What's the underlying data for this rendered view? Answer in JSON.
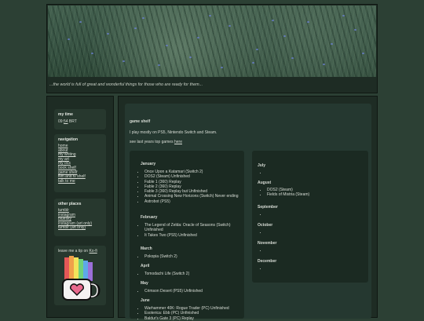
{
  "header": {
    "tagline": "...the world is full of great and wonderful things for those who are ready for them..."
  },
  "sidebar": {
    "time": {
      "title": "my time",
      "value_prefix": "09:",
      "value_link": "54",
      "value_suffix": " BRT"
    },
    "navigation": {
      "title": "navigation",
      "items": [
        "home",
        "about",
        "my writing",
        "my art",
        "my ocs",
        "book shelf",
        "game shelf",
        "film and tv shelf",
        "talk to me"
      ]
    },
    "other_places": {
      "title": "other places",
      "items": [
        "tumblr",
        "instagram",
        "bluesky",
        "instagram (art only)",
        "tumblr (art only)"
      ]
    },
    "kofi": {
      "text": "leave me a tip on ",
      "link": "Ko-fi"
    }
  },
  "main": {
    "title": "game shelf",
    "intro": "I play mostly on PS5, Nintendo Switch and Steam.",
    "last_year_prefix": "see last years top games ",
    "last_year_link": "here",
    "left_months": [
      {
        "name": "January",
        "games": [
          "Once Upon a Katamari (Switch 2)",
          "DOS2 (Steam) Unfinished",
          "Fable 1 (360) Replay",
          "Fable 2 (360) Replay",
          "Fable 3 (360) Replay but Unfinished",
          "Animal Crossing New Horizons (Switch) Never ending",
          "Astrobot (PS5)"
        ]
      },
      {
        "name": "February",
        "games": [
          "The Legend of Zelda: Oracle of Seasons (Switch) Unfinished",
          "It Takes Two (PS5) Unfinished"
        ]
      },
      {
        "name": "March",
        "games": [
          "Pokopia (Switch 2)"
        ]
      },
      {
        "name": "April",
        "games": [
          "Tomodachi Life (Switch 2)"
        ]
      },
      {
        "name": "May",
        "games": [
          "Crimson Desert (PS5) Unfinished"
        ]
      },
      {
        "name": "June",
        "games": [
          "Warhammer 40K: Rogue Trader (PC) Unfinished",
          "Esoterica: Ebb (PC) Unfinished",
          "Baldur's Gate 3 (PC) Replay"
        ]
      }
    ],
    "right_months": [
      {
        "name": "July",
        "games": [
          ""
        ]
      },
      {
        "name": "August",
        "games": [
          "DOS2 (Steam)",
          "Fields of Mistria (Steam)"
        ]
      },
      {
        "name": "September",
        "games": [
          ""
        ]
      },
      {
        "name": "October",
        "games": [
          ""
        ]
      },
      {
        "name": "November",
        "games": [
          ""
        ]
      },
      {
        "name": "December",
        "games": [
          ""
        ]
      }
    ]
  },
  "colors": {
    "background": "#2c4034",
    "panel": "#1e2c24",
    "text": "#d8ddd6"
  }
}
